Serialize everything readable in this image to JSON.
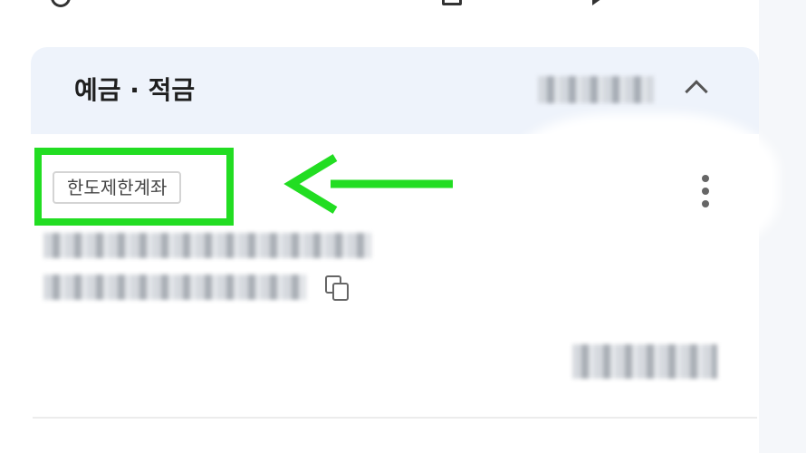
{
  "section": {
    "title": "예금 · 적금"
  },
  "account": {
    "badge_label": "한도제한계좌"
  },
  "icons": {
    "top_left": "info-circle-icon",
    "top_middle": "document-icon",
    "top_right": "play-icon",
    "collapse": "chevron-up-icon",
    "more": "more-vertical-icon",
    "copy": "copy-icon",
    "annotation": "arrow-left-icon"
  },
  "colors": {
    "highlight": "#22dd22",
    "header_bg": "#eef3fb",
    "badge_border": "#d4d4d4"
  }
}
